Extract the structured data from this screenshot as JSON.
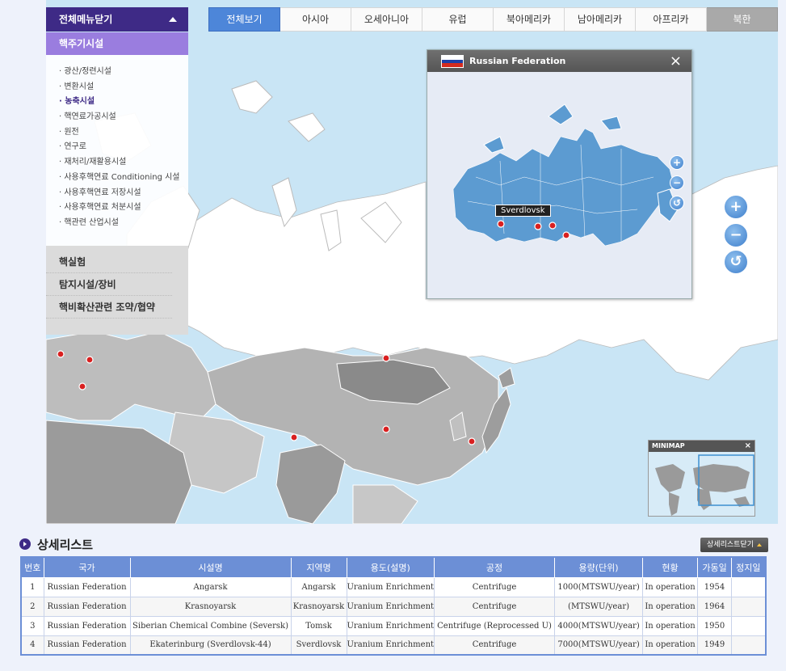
{
  "menu": {
    "toggle_label": "전체메뉴닫기",
    "section_header": "핵주기시설",
    "items": [
      "광산/정련시설",
      "변환시설",
      "농축시설",
      "핵연료가공시설",
      "원전",
      "연구로",
      "재처리/재활용시설",
      "사용후핵연료 Conditioning 시설",
      "사용후핵연료 저장시설",
      "사용후핵연료 처분시설",
      "핵관련 산업시설"
    ],
    "selected_index": 2,
    "groups": [
      "핵실험",
      "탐지시설/장비",
      "핵비확산관련 조약/협약"
    ]
  },
  "tabs": [
    "전체보기",
    "아시아",
    "오세아니아",
    "유럽",
    "북아메리카",
    "남아메리카",
    "아프리카",
    "북한"
  ],
  "popup": {
    "country": "Russian Federation",
    "flag_colors": [
      "#ffffff",
      "#1c3fa8",
      "#d52b1e"
    ],
    "close_icon": "×",
    "marker_label": "Sverdlovsk"
  },
  "zoom": {
    "in": "+",
    "out": "−",
    "reset": "↺"
  },
  "minimap": {
    "title": "MINIMAP",
    "close_icon": "×"
  },
  "detail": {
    "title": "상세리스트",
    "close_button": "상세리스트닫기",
    "columns": [
      "번호",
      "국가",
      "시설명",
      "지역명",
      "용도(설명)",
      "공정",
      "용량(단위)",
      "현황",
      "가동일",
      "정지일"
    ],
    "rows": [
      [
        "1",
        "Russian Federation",
        "Angarsk",
        "Angarsk",
        "Uranium Enrichment",
        "Centrifuge",
        "1000(MTSWU/year)",
        "In operation",
        "1954",
        ""
      ],
      [
        "2",
        "Russian Federation",
        "Krasnoyarsk",
        "Krasnoyarsk",
        "Uranium Enrichment",
        "Centrifuge",
        "(MTSWU/year)",
        "In operation",
        "1964",
        ""
      ],
      [
        "3",
        "Russian Federation",
        "Siberian Chemical Combine (Seversk)",
        "Tomsk",
        "Uranium Enrichment",
        "Centrifuge (Reprocessed U)",
        "4000(MTSWU/year)",
        "In operation",
        "1950",
        ""
      ],
      [
        "4",
        "Russian Federation",
        "Ekaterinburg (Sverdlovsk-44)",
        "Sverdlovsk",
        "Uranium Enrichment",
        "Centrifuge",
        "7000(MTSWU/year)",
        "In operation",
        "1949",
        ""
      ]
    ]
  },
  "colors": {
    "menu_dark": "#3e2a86",
    "menu_light": "#9a7ddf",
    "tab_active": "#4d86d9",
    "sea": "#c9e5f5",
    "land": "#a9a9a9",
    "russia": "#ffffff",
    "marker": "#d92020",
    "popup_land": "#5c9bd1"
  }
}
